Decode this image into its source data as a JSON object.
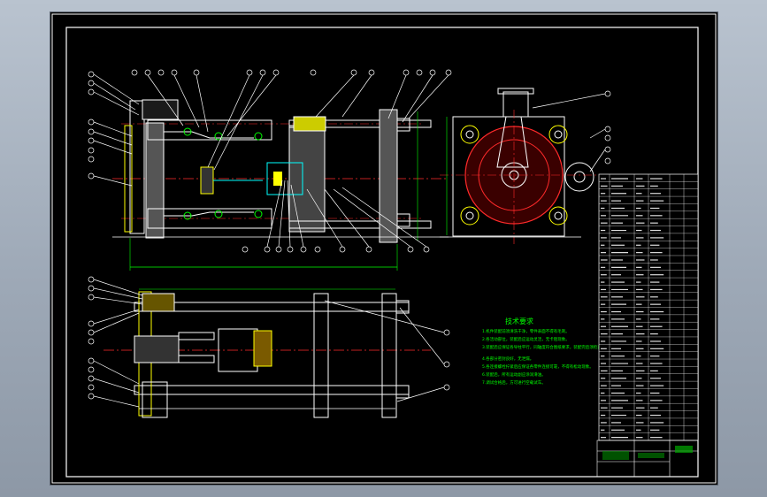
{
  "app": {
    "canvas_background": "#000000",
    "workspace_background": "#a3adba"
  },
  "drawing": {
    "tech_requirements_title": "技术要求",
    "tech_requirements_lines": [
      "1.机件装配前须清洗干净，零件表面不得有毛刺。",
      "2.各活动部位，装配后应运动灵活，无卡阻现象。",
      "3.装配后应保证各导柱平行，同轴度符合图纸要求，装配完后须检查动作情况。",
      "4.各部分密封良好，无泄漏。",
      "5.各连接螺栓拧紧后应保证各零件连接可靠，不得有松动现象。",
      "6.装配后，所有运动副应涂润滑油。",
      "7.调试合格后，方可进行空载试车。"
    ],
    "colors": {
      "outline": "#ffffff",
      "centerline": "#ff2a2a",
      "section": "#ffff00",
      "dimension": "#00ff00",
      "hidden": "#00ffff",
      "hatch": "#ff00ff"
    }
  }
}
